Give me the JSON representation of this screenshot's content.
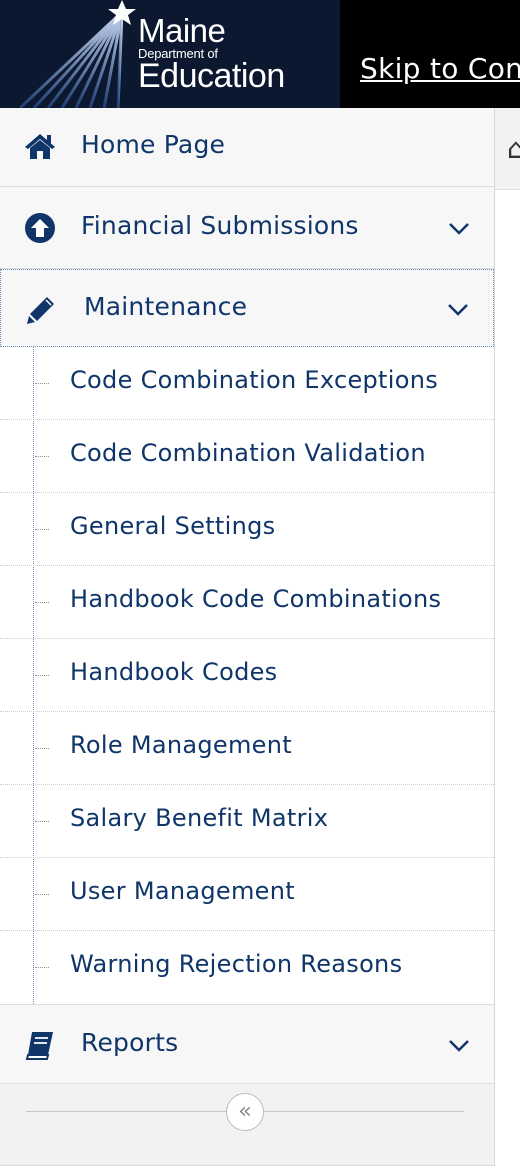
{
  "header": {
    "logo": {
      "line1": "Maine",
      "line2": "Department of",
      "line3": "Education"
    },
    "skip_link": "Skip to Con"
  },
  "sidebar": {
    "home": {
      "label": "Home Page",
      "icon": "home-icon"
    },
    "financial": {
      "label": "Financial Submissions",
      "icon": "arrow-circle-up-icon"
    },
    "maintenance": {
      "label": "Maintenance",
      "icon": "pencil-icon",
      "items": [
        "Code Combination Exceptions",
        "Code Combination Validation",
        "General Settings",
        "Handbook Code Combinations",
        "Handbook Codes",
        "Role Management",
        "Salary Benefit Matrix",
        "User Management",
        "Warning Rejection Reasons"
      ]
    },
    "reports": {
      "label": "Reports",
      "icon": "book-icon"
    },
    "collapse_glyph": "«"
  },
  "colors": {
    "nav_text": "#0f3569",
    "sidebar_bg": "#f7f7f7",
    "header_bg": "#000000"
  }
}
